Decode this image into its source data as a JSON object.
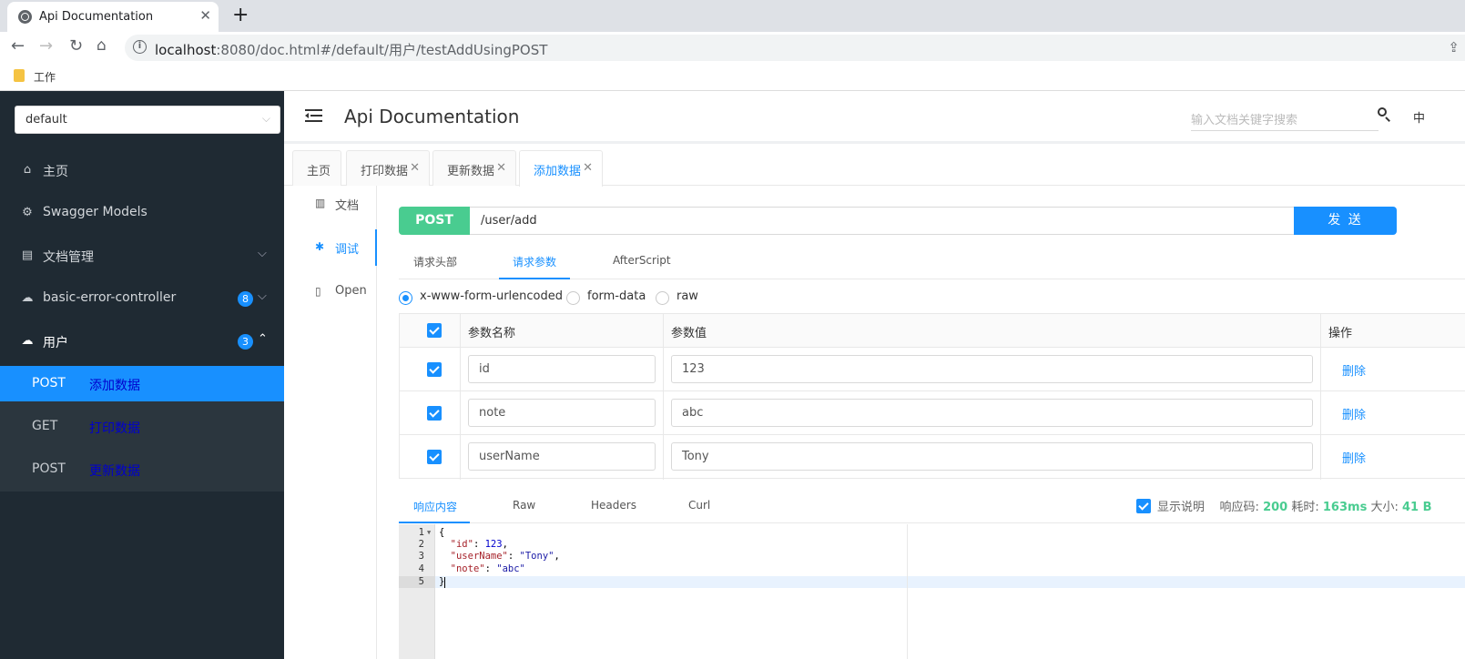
{
  "browser": {
    "tab_title": "Api Documentation",
    "tab_close": "✕",
    "new_tab": "+",
    "url_host": "localhost",
    "url_rest": ":8080/doc.html#/default/用户/testAddUsingPOST",
    "bookmark": "工作"
  },
  "sidebar": {
    "group_select": "default",
    "items": [
      {
        "label": "主页",
        "icon": "home-icon"
      },
      {
        "label": "Swagger Models",
        "icon": "models-icon"
      },
      {
        "label": "文档管理",
        "icon": "doc-manage-icon"
      },
      {
        "label": "basic-error-controller",
        "badge": "8",
        "icon": "cloud-icon"
      },
      {
        "label": "用户",
        "badge": "3",
        "icon": "cloud-icon"
      }
    ],
    "sub_items": [
      {
        "method": "POST",
        "name": "添加数据"
      },
      {
        "method": "GET",
        "name": "打印数据"
      },
      {
        "method": "POST",
        "name": "更新数据"
      }
    ]
  },
  "header": {
    "title": "Api Documentation",
    "search_placeholder": "输入文档关键字搜索",
    "lang": "中"
  },
  "tabs": [
    {
      "label": "主页"
    },
    {
      "label": "打印数据"
    },
    {
      "label": "更新数据"
    },
    {
      "label": "添加数据"
    }
  ],
  "doc_nav": [
    {
      "label": "文档"
    },
    {
      "label": "调试"
    },
    {
      "label": "Open"
    }
  ],
  "request": {
    "method": "POST",
    "path": "/user/add",
    "send": "发 送"
  },
  "request_tabs": [
    "请求头部",
    "请求参数",
    "AfterScript"
  ],
  "content_types": [
    "x-www-form-urlencoded",
    "form-data",
    "raw"
  ],
  "params_table": {
    "headers": {
      "name": "参数名称",
      "value": "参数值",
      "op": "操作"
    },
    "rows": [
      {
        "name": "id",
        "value": "123",
        "action": "删除"
      },
      {
        "name": "note",
        "value": "abc",
        "action": "删除"
      },
      {
        "name": "userName",
        "value": "Tony",
        "action": "删除"
      }
    ]
  },
  "response": {
    "tabs": [
      "响应内容",
      "Raw",
      "Headers",
      "Curl"
    ],
    "show_desc": "显示说明",
    "code_label": "响应码:",
    "code": "200",
    "time_label": "耗时:",
    "time": "163ms",
    "size_label": "大小:",
    "size": "41 B",
    "lines": [
      "1",
      "2",
      "3",
      "4",
      "5"
    ],
    "json": {
      "open": "{",
      "k1": "\"id\"",
      "v1": "123",
      "k2": "\"userName\"",
      "v2": "\"Tony\"",
      "k3": "\"note\"",
      "v3": "\"abc\"",
      "close": "}"
    }
  },
  "colors": {
    "primary": "#1890ff",
    "post": "#49cc90",
    "sidebar": "#1f2a33"
  }
}
